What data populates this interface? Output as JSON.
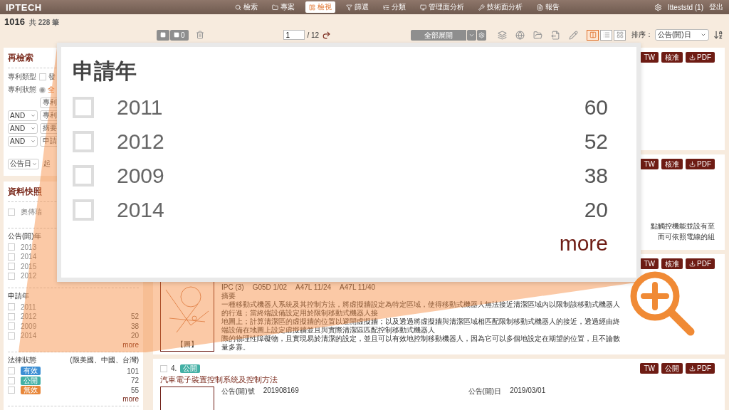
{
  "header": {
    "logo": "IPTECH",
    "nav": [
      {
        "label": "檢索",
        "selected": false
      },
      {
        "label": "專案",
        "selected": false
      },
      {
        "label": "檢視",
        "selected": true
      },
      {
        "label": "篩選",
        "selected": false
      },
      {
        "label": "分類",
        "selected": false
      },
      {
        "label": "管理面分析",
        "selected": false
      },
      {
        "label": "技術面分析",
        "selected": false
      },
      {
        "label": "報告",
        "selected": false
      }
    ],
    "user": "Itteststd (1)",
    "logout": "登出"
  },
  "summary": {
    "count": "1016",
    "total": "共 228 筆"
  },
  "toolbar": {
    "select_count": "0",
    "page": "1",
    "pages": "/ 12",
    "expand": "全部展開",
    "views": [
      {
        "selected": true
      },
      {
        "selected": false
      },
      {
        "selected": false
      }
    ],
    "sort_label": "排序：",
    "sort_value": "公告(開)日"
  },
  "research": {
    "title": "再檢索",
    "type_label": "專利類型",
    "type_option": "發",
    "type_checked": false,
    "status_label": "專利狀態",
    "status_option": "全",
    "status_selected": true,
    "field_top": "專利",
    "rows": [
      {
        "op": "AND",
        "field": "專利"
      },
      {
        "op": "AND",
        "field": "摘要"
      },
      {
        "op": "AND",
        "field": "申請"
      }
    ],
    "date_field": "公告日",
    "date_from": "起"
  },
  "snapshot": {
    "title": "資料快照",
    "top_items": [
      {
        "label": "奧傳瑞",
        "checked": false
      }
    ],
    "groups": [
      {
        "title": "公告(開)年",
        "kind": "plain",
        "items": [
          {
            "label": "2013",
            "checked": false
          },
          {
            "label": "2014",
            "checked": false
          },
          {
            "label": "2015",
            "checked": false
          },
          {
            "label": "2012",
            "checked": false
          }
        ]
      },
      {
        "title": "申請年",
        "kind": "plain",
        "items": [
          {
            "label": "2011",
            "checked": false
          },
          {
            "label": "2012",
            "count": "52",
            "checked": false
          },
          {
            "label": "2009",
            "count": "38",
            "checked": false
          },
          {
            "label": "2014",
            "count": "20",
            "checked": false
          }
        ],
        "more": "more"
      },
      {
        "title": "法律狀態",
        "kind": "badges",
        "note": "(限美國、中國、台灣)",
        "items": [
          {
            "label": "有效",
            "color": "#3d8fd4",
            "count": "101",
            "checked": false
          },
          {
            "label": "公開",
            "color": "#43b0a5",
            "count": "72",
            "checked": false
          },
          {
            "label": "無效",
            "color": "#e8873a",
            "count": "55",
            "checked": false
          }
        ],
        "more": "more"
      }
    ]
  },
  "popup": {
    "title": "申請年",
    "items": [
      {
        "label": "2011",
        "count": "60",
        "checked": false
      },
      {
        "label": "2012",
        "count": "52",
        "checked": false
      },
      {
        "label": "2009",
        "count": "38",
        "checked": false
      },
      {
        "label": "2014",
        "count": "20",
        "checked": false
      }
    ],
    "more": "more"
  },
  "cards": [
    {
      "buttons": [
        {
          "label": "TW",
          "kind": "tag"
        },
        {
          "label": "核准",
          "kind": "tag"
        },
        {
          "label": "PDF",
          "kind": "pdf"
        }
      ]
    },
    {
      "buttons": [
        {
          "label": "TW",
          "kind": "tag"
        },
        {
          "label": "核准",
          "kind": "tag"
        },
        {
          "label": "PDF",
          "kind": "pdf"
        }
      ],
      "abstract_tail": [
        "點觸控機能並設有至",
        "而可依照電線的組"
      ]
    },
    {
      "buttons": [
        {
          "label": "TW",
          "kind": "tag"
        },
        {
          "label": "核准",
          "kind": "tag"
        },
        {
          "label": "PDF",
          "kind": "pdf"
        }
      ],
      "image_caption": "【圖】",
      "ipc": [
        "IPC (3)",
        "G05D 1/02",
        "A47L 11/24",
        "A47L 11/40"
      ],
      "abstract_label": "摘要",
      "abstract": [
        "一種移動式機器人系統及其控制方法，將虛擬牆設定為特定區域，使得移動式機器人無法接近清潔區域內以限制該移動式機器人的行進；當終端設備設定用於限制移動式機器人接",
        "地圖上；計算清潔區的虛擬牆的位置以避開虛擬牆；以及透過將虛擬牆與清潔區域相匹配限制移動式機器人的接近，透過經由終端設備在地圖上設定虛擬牆並且與實際清潔區匹配控制移動式機器人",
        "際的物理性障礙物，且實現易於清潔的設定，並且可以有效地控制移動機器人，因為它可以多個地設定在期望的位置，且不論數量多寡。"
      ]
    },
    {
      "checked": false,
      "number": "4.",
      "badge": {
        "label": "公開",
        "color": "#43b0a5"
      },
      "title": "汽車電子裝置控制系統及控制方法",
      "buttons": [
        {
          "label": "TW",
          "kind": "tag"
        },
        {
          "label": "公開",
          "kind": "tag"
        },
        {
          "label": "PDF",
          "kind": "pdf"
        }
      ],
      "fields": [
        {
          "label": "公告(開)號",
          "value": "201908169"
        },
        {
          "label": "公告(開)日",
          "value": "2019/03/01"
        }
      ]
    }
  ]
}
